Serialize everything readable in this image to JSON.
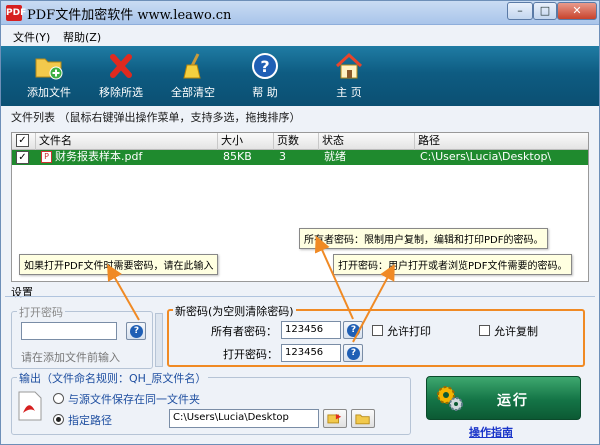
{
  "window": {
    "title": "PDF文件加密软件 www.leawo.cn",
    "app_icon": "PDF",
    "min": "–",
    "max": "□",
    "close": "✕"
  },
  "menu": [
    {
      "label": "文件(Y)"
    },
    {
      "label": "帮助(Z)"
    }
  ],
  "toolbar": {
    "buttons": [
      {
        "label": "添加文件",
        "icon": "add-folder-icon"
      },
      {
        "label": "移除所选",
        "icon": "red-x-icon"
      },
      {
        "label": "全部清空",
        "icon": "broom-icon"
      },
      {
        "label": "帮 助",
        "icon": "help-icon"
      },
      {
        "label": "主 页",
        "icon": "home-icon"
      }
    ]
  },
  "file_list": {
    "label": "文件列表  （鼠标右键弹出操作菜单，支持多选，拖拽排序）",
    "headers": {
      "name": "文件名",
      "size": "大小",
      "pages": "页数",
      "status": "状态",
      "path": "路径"
    },
    "rows": [
      {
        "checked": true,
        "name": "财务报表样本.pdf",
        "size": "85KB",
        "pages": "3",
        "status": "就绪",
        "path": "C:\\Users\\Lucia\\Desktop\\"
      }
    ],
    "header_check": "✓",
    "row_check": "✓",
    "pdf_icon": "P"
  },
  "tips": {
    "owner": "所有者密码：限制用户复制，编辑和打印PDF的密码。",
    "open_pwd": "打开密码：用户打开或者浏览PDF文件需要的密码。",
    "open_file": "如果打开PDF文件时需要密码，请在此输入"
  },
  "settings": {
    "label": "设置",
    "open_password_group": {
      "title": "打开密码",
      "input_value": "",
      "hint": "请在添加文件前输入"
    },
    "new_password_group": {
      "title": "新密码(为空则清除密码)",
      "owner_label": "所有者密码：",
      "owner_value": "123456",
      "open_label": "打开密码：",
      "open_value": "123456",
      "allow_print": "允许打印",
      "allow_copy": "允许复制"
    },
    "output_group": {
      "title": "输出（文件命名规则：QH_原文件名）",
      "same_folder": "与源文件保存在同一文件夹",
      "custom_path": "指定路径",
      "path_value": "C:\\Users\\Lucia\\Desktop"
    },
    "help_glyph": "?"
  },
  "run": {
    "label": "运行"
  },
  "guide": {
    "label": "操作指南"
  },
  "colors": {
    "toolbar": "#0e5c82",
    "selected_row": "#1f8a2e",
    "arrow": "#f08a24",
    "link": "#1a35c9"
  }
}
